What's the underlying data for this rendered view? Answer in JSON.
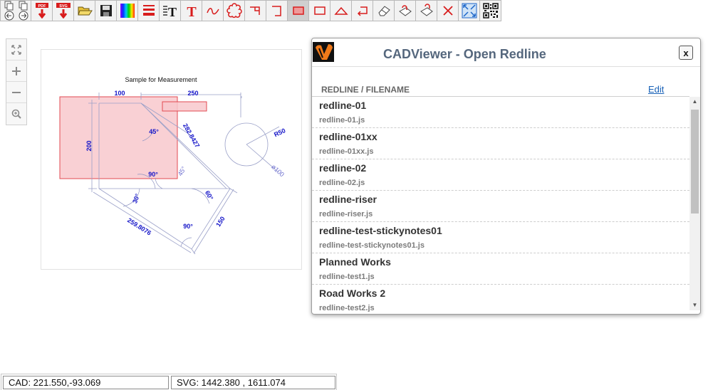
{
  "toolbar": {
    "buttons": [
      {
        "id": "copy-back",
        "icon": "copy-icon"
      },
      {
        "id": "pdf-download",
        "icon": "pdf-download-icon",
        "label": "PDF"
      },
      {
        "id": "svg-download",
        "icon": "svg-download-icon",
        "label": "SVG"
      },
      {
        "id": "open-folder",
        "icon": "folder-open-icon"
      },
      {
        "id": "save",
        "icon": "save-icon"
      },
      {
        "id": "color-picker",
        "icon": "color-palette-icon"
      },
      {
        "id": "line-weight",
        "icon": "line-weight-icon"
      },
      {
        "id": "text-tool",
        "icon": "text-icon"
      },
      {
        "id": "red-text-tool",
        "icon": "red-text-icon"
      },
      {
        "id": "freehand",
        "icon": "freehand-icon"
      },
      {
        "id": "cloud",
        "icon": "cloud-icon"
      },
      {
        "id": "polyline-step",
        "icon": "step-line-icon"
      },
      {
        "id": "polyline-bracket",
        "icon": "bracket-line-icon"
      },
      {
        "id": "filled-rectangle",
        "icon": "filled-rectangle-icon"
      },
      {
        "id": "rectangle",
        "icon": "rectangle-icon"
      },
      {
        "id": "triangle",
        "icon": "triangle-icon"
      },
      {
        "id": "arrow-line",
        "icon": "arrow-line-icon"
      },
      {
        "id": "eraser",
        "icon": "eraser-icon"
      },
      {
        "id": "lock-redline",
        "icon": "lock-icon"
      },
      {
        "id": "unlock-redline",
        "icon": "unlock-icon"
      },
      {
        "id": "delete",
        "icon": "delete-x-icon"
      },
      {
        "id": "fit-screen",
        "icon": "fit-to-screen-icon"
      },
      {
        "id": "qr-code",
        "icon": "qr-code-icon"
      }
    ],
    "pdf_label": "PDF",
    "svg_label": "SVG",
    "text_glyph": "T",
    "accent_red": "#e21d1d"
  },
  "zoom_panel": {
    "icons": [
      "fullscreen-icon",
      "zoom-in-icon",
      "zoom-out-icon",
      "zoom-window-icon"
    ]
  },
  "drawing": {
    "title": "Sample for Measurement",
    "dims": {
      "d100": "100",
      "d250": "250",
      "d200": "200",
      "d282": "282.8427",
      "d45a": "45°",
      "d45b": "45°",
      "d90a": "90°",
      "d30": "30°",
      "d60": "60°",
      "d90b": "90°",
      "d259": "259.8076",
      "d150": "150",
      "r50": "R50",
      "dia100": "ø100"
    },
    "dimension_color": "#1414c8"
  },
  "dialog": {
    "title": "CADViewer - Open Redline",
    "close_label": "x",
    "column_header": "REDLINE / FILENAME",
    "edit_label": "Edit",
    "items": [
      {
        "name": "redline-01",
        "file": "redline-01.js"
      },
      {
        "name": "redline-01xx",
        "file": "redline-01xx.js"
      },
      {
        "name": "redline-02",
        "file": "redline-02.js"
      },
      {
        "name": "redline-riser",
        "file": "redline-riser.js"
      },
      {
        "name": "redline-test-stickynotes01",
        "file": "redline-test-stickynotes01.js"
      },
      {
        "name": "Planned Works",
        "file": "redline-test1.js"
      },
      {
        "name": "Road Works 2",
        "file": "redline-test2.js"
      }
    ]
  },
  "status": {
    "cad": "CAD: 221.550,-93.069",
    "svg": "SVG: 1442.380 , 1611.074"
  }
}
